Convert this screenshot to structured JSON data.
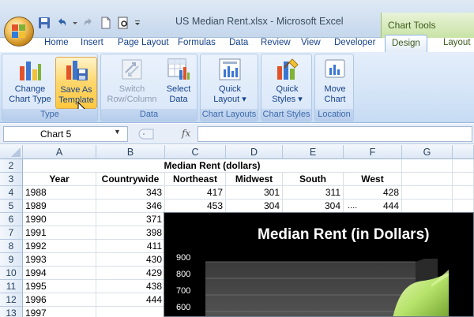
{
  "window": {
    "title": "US Median Rent.xlsx - Microsoft Excel",
    "contextual_tab": "Chart Tools"
  },
  "tabs": [
    "Home",
    "Insert",
    "Page Layout",
    "Formulas",
    "Data",
    "Review",
    "View",
    "Developer",
    "Design",
    "Layout"
  ],
  "active_tab": "Design",
  "ribbon": {
    "groups": [
      {
        "label": "Type",
        "buttons": [
          {
            "line1": "Change",
            "line2": "Chart Type"
          },
          {
            "line1": "Save As",
            "line2": "Template"
          }
        ]
      },
      {
        "label": "Data",
        "buttons": [
          {
            "line1": "Switch",
            "line2": "Row/Column"
          },
          {
            "line1": "Select",
            "line2": "Data"
          }
        ]
      },
      {
        "label": "Chart Layouts",
        "buttons": [
          {
            "line1": "Quick",
            "line2": "Layout ▾"
          }
        ]
      },
      {
        "label": "Chart Styles",
        "buttons": [
          {
            "line1": "Quick",
            "line2": "Styles ▾"
          }
        ]
      },
      {
        "label": "Location",
        "buttons": [
          {
            "line1": "Move",
            "line2": "Chart"
          }
        ]
      }
    ]
  },
  "formula_bar": {
    "name_box": "Chart 5",
    "fx": "fx",
    "formula": ""
  },
  "sheet": {
    "columns": [
      "A",
      "B",
      "C",
      "D",
      "E",
      "F",
      "G"
    ],
    "rows": [
      "2",
      "3",
      "4",
      "5",
      "6",
      "7",
      "8",
      "9",
      "10",
      "11",
      "12",
      "13"
    ],
    "merged_title": "Median Rent (dollars)",
    "headers": [
      "Year",
      "Countrywide",
      "Northeast",
      "Midwest",
      "South",
      "West"
    ],
    "data": [
      [
        "1988",
        "343",
        "417",
        "301",
        "311",
        "428"
      ],
      [
        "1989",
        "346",
        "453",
        "304",
        "304",
        "444"
      ],
      [
        "1990",
        "371",
        "",
        "",
        "",
        ""
      ],
      [
        "1991",
        "398",
        "",
        "",
        "",
        ""
      ],
      [
        "1992",
        "411",
        "",
        "",
        "",
        ""
      ],
      [
        "1993",
        "430",
        "",
        "",
        "",
        ""
      ],
      [
        "1994",
        "429",
        "",
        "",
        "",
        ""
      ],
      [
        "1995",
        "438",
        "",
        "",
        "",
        ""
      ],
      [
        "1996",
        "444",
        "",
        "",
        "",
        ""
      ],
      [
        "1997",
        "",
        "",
        "",
        "",
        ""
      ]
    ],
    "row5_ellipsis": "....",
    "chart": {
      "title": "Median Rent (in Dollars)",
      "yticks": [
        "900",
        "800",
        "700",
        "600"
      ]
    }
  },
  "colors": {
    "ribbon_bg": "#d4e4f7",
    "contextual_green": "#c9e3a6",
    "hover_orange": "#ffd66b",
    "chart_bg": "#000000",
    "series_green": "#b6e36a"
  }
}
